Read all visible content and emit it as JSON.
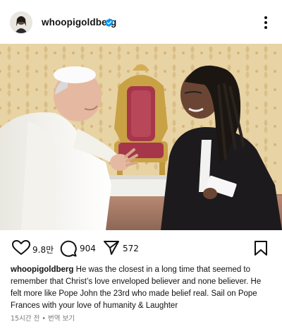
{
  "header": {
    "username": "whoopigoldberg",
    "verified": true,
    "avatar_icon": "profile-avatar",
    "more_icon": "vertical-ellipsis-icon"
  },
  "post": {
    "image_alt_icon": "post-photo",
    "likes": "9.8만",
    "comments": "904",
    "shares": "572"
  },
  "caption": {
    "username": "whoopigoldberg",
    "text": "He was the closest in a long time that seemed to remember that Christ’s love enveloped believer and none believer. He felt more like Pope John the 23rd who made belief real. Sail on Pope Frances with your love of humanity & Laughter"
  },
  "meta": {
    "time": "15시간 전",
    "separator": "•",
    "translate": "번역 보기"
  },
  "colors": {
    "verified_badge": "#0095f6",
    "text": "#111111",
    "meta_text": "#777777"
  }
}
